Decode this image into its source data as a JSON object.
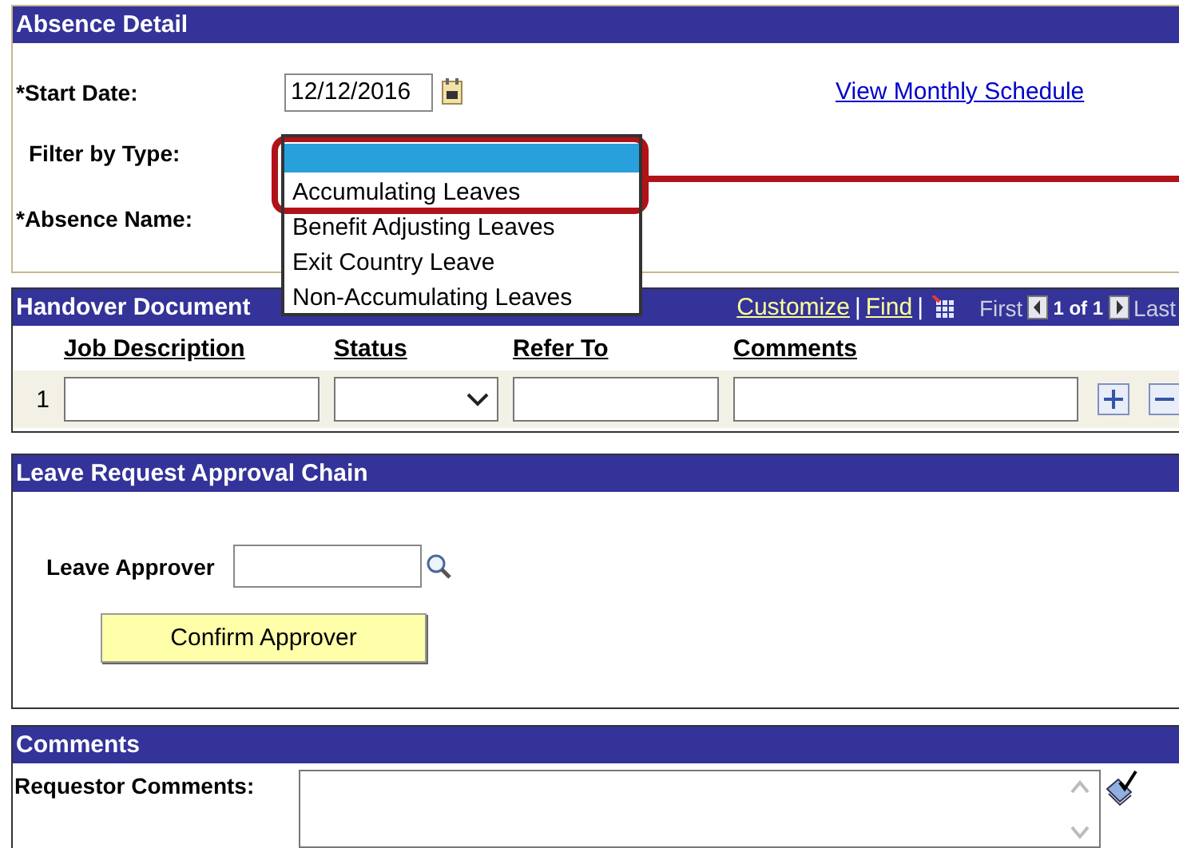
{
  "absence_detail": {
    "title": "Absence Detail",
    "start_date": {
      "label": "*Start Date:",
      "value": "12/12/2016"
    },
    "schedule_link": "View Monthly Schedule",
    "filter_label": "Filter by Type:",
    "absence_name_label": "*Absence Name:",
    "filter_options": [
      {
        "selected": true
      },
      {
        "label": "Accumulating Leaves",
        "selected": false
      },
      {
        "label": "Benefit Adjusting Leaves",
        "selected": false
      },
      {
        "label": "Exit Country Leave",
        "selected": false
      },
      {
        "label": "Non-Accumulating Leaves",
        "selected": false
      }
    ]
  },
  "handover": {
    "title": "Handover Document",
    "links": [
      "Customize",
      "Find"
    ],
    "separators": [
      "|",
      "|"
    ],
    "nav_first": "First",
    "nav_count": "1 of 1",
    "nav_last": "Last",
    "columns": [
      "Job Description",
      "Status",
      "Refer To",
      "Comments"
    ],
    "rows": [
      {
        "number": "1"
      }
    ]
  },
  "approval": {
    "title": "Leave Request Approval Chain",
    "approver_label": "Leave Approver",
    "confirm_button": "Confirm Approver"
  },
  "comments": {
    "title": "Comments",
    "requestor_label": "Requestor Comments:"
  }
}
